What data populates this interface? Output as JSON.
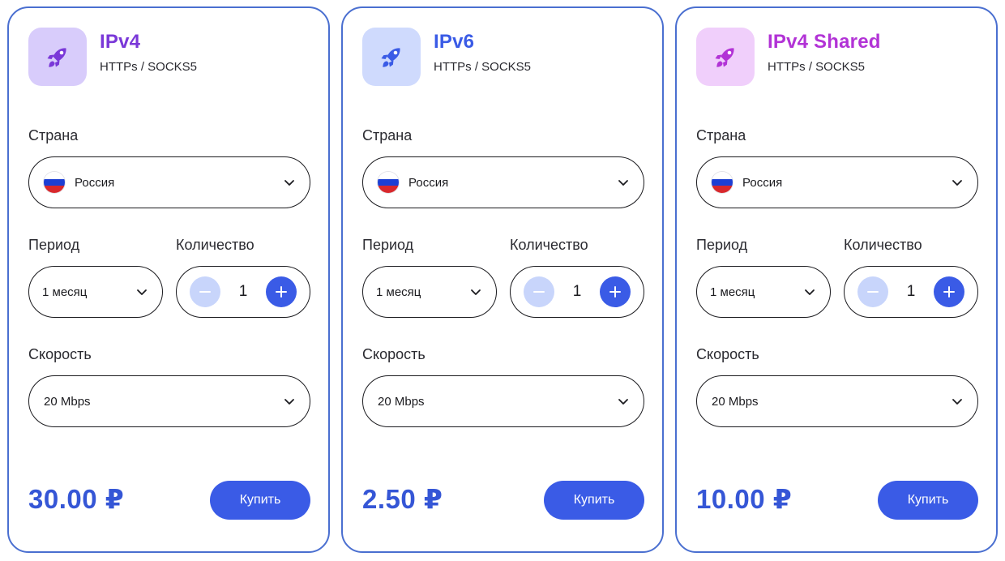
{
  "colors": {
    "accent": "#3a5be6",
    "border": "#4a6fd0",
    "price": "#3556d6",
    "minus_bg": "#c8d5fb",
    "flag": [
      "#ffffff",
      "#1c3fd4",
      "#d8282c"
    ]
  },
  "cards": [
    {
      "title": "IPv4",
      "subtitle": "HTTPs / SOCKS5",
      "icon": "rocket-icon",
      "title_color": "#7a38d8",
      "icon_bg": "#d8ccfb",
      "icon_color": "#7a38d8",
      "country_label": "Страна",
      "country_value": "Россия",
      "period_label": "Период",
      "period_value": "1 месяц",
      "quantity_label": "Количество",
      "quantity_value": "1",
      "speed_label": "Скорость",
      "speed_value": "20 Mbps",
      "price": "30.00 ₽",
      "buy_label": "Купить"
    },
    {
      "title": "IPv6",
      "subtitle": "HTTPs / SOCKS5",
      "icon": "rocket-icon",
      "title_color": "#3a5be6",
      "icon_bg": "#cfdafd",
      "icon_color": "#3a5be6",
      "country_label": "Страна",
      "country_value": "Россия",
      "period_label": "Период",
      "period_value": "1 месяц",
      "quantity_label": "Количество",
      "quantity_value": "1",
      "speed_label": "Скорость",
      "speed_value": "20 Mbps",
      "price": "2.50 ₽",
      "buy_label": "Купить"
    },
    {
      "title": "IPv4 Shared",
      "subtitle": "HTTPs / SOCKS5",
      "icon": "rocket-icon",
      "title_color": "#b233d6",
      "icon_bg": "#f0cffb",
      "icon_color": "#b233d6",
      "country_label": "Страна",
      "country_value": "Россия",
      "period_label": "Период",
      "period_value": "1 месяц",
      "quantity_label": "Количество",
      "quantity_value": "1",
      "speed_label": "Скорость",
      "speed_value": "20 Mbps",
      "price": "10.00 ₽",
      "buy_label": "Купить"
    }
  ]
}
